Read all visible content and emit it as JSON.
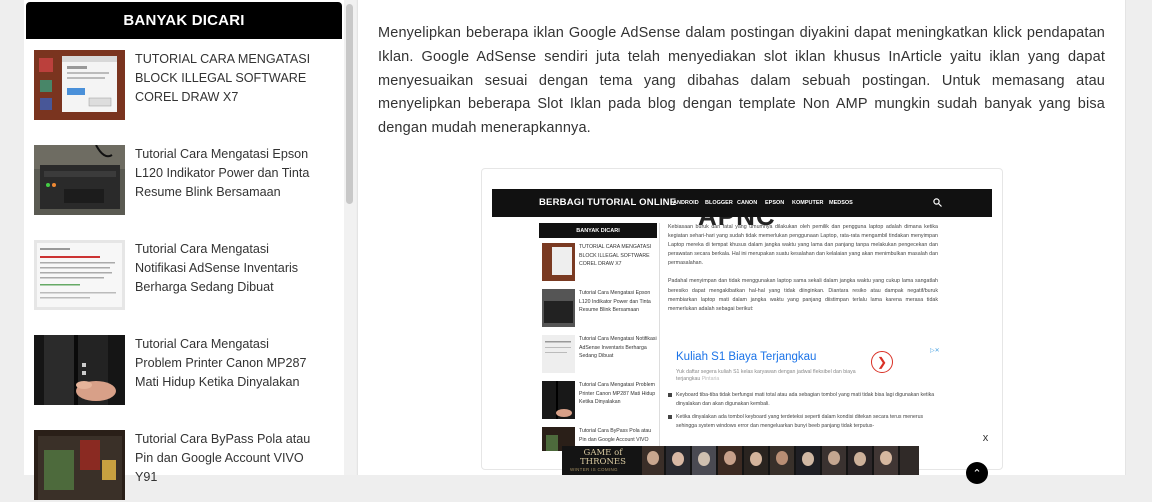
{
  "sidebar": {
    "widget_title": "BANYAK DICARI",
    "posts": [
      {
        "title": "TUTORIAL CARA MENGATASI BLOCK ILLEGAL SOFTWARE COREL DRAW X7"
      },
      {
        "title": "Tutorial Cara Mengatasi Epson L120 Indikator Power dan Tinta Resume Blink Bersamaan"
      },
      {
        "title": "Tutorial Cara Mengatasi Notifikasi AdSense Inventaris Berharga Sedang Dibuat"
      },
      {
        "title": "Tutorial Cara Mengatasi Problem Printer Canon MP287 Mati Hidup Ketika Dinyalakan"
      },
      {
        "title": "Tutorial Cara ByPass Pola atau Pin dan Google Account VIVO Y91"
      }
    ]
  },
  "article": {
    "paragraph": "Menyelipkan beberapa iklan Google AdSense dalam postingan diyakini dapat meningkatkan klick pendapatan Iklan. Google AdSense sendiri juta telah menyediakan slot iklan khusus InArticle yaitu iklan yang dapat menyesuaikan sesuai dengan tema yang dibahas dalam sebuah postingan. Untuk memasang atau menyelipkan  beberapa Slot Iklan pada blog dengan template Non AMP mungkin sudah banyak yang bisa dengan mudah menerapkannya."
  },
  "embedded_screenshot": {
    "brand": "BERBAGI TUTORIAL ONLINE",
    "menu": [
      "ANDROID",
      "BLOGGER",
      "CANON",
      "EPSON",
      "KOMPUTER",
      "MEDSOS"
    ],
    "heading_fragment": "APNC",
    "sidebar_title": "BANYAK DICARI",
    "posts": [
      "TUTORIAL CARA MENGATASI BLOCK ILLEGAL SOFTWARE COREL DRAW X7",
      "Tutorial Cara Mengatasi Epson L120 Indikator Power dan Tinta Resume Blink Bersamaan",
      "Tutorial Cara Mengatasi Notifikasi AdSense Inventaris Berharga Sedang Dibuat",
      "Tutorial Cara Mengatasi Problem Printer Canon MP287 Mati Hidup Ketika Dinyalakan",
      "Tutorial Cara ByPass Pola atau Pin dan Google Account VIVO"
    ],
    "content_p1": "Kebiasaan buruk dan fatal yang umumnya dilakukan oleh pemilik dan pengguna laptop adalah dimana ketika kegiatan sehari-hari yang sudah tidak memerlukan penggunaan Laptop, rata-rata mengambil tindakan menyimpan Laptop mereka di tempat khusus dalam jangka waktu yang lama dan panjang tanpa melakukan pengecekan dan perawatan secara berkala. Hal ini merupakan suatu kesalahan dan kelalaian yang akan menimbulkan masalah dan permasalahan.",
    "content_p2": "Padahal menyimpan dan tidak menggunakan laptop sama sekali dalam jangka waktu yang cukup lama sangatlah beresiko dapat mengakibatkan hal-hal yang tidak diinginkan. Diantara resiko atau dampak negatif/buruk membiarkan laptop mati dalam jangka waktu yang panjang diistimpan terlalu lama karena merasa tidak memerlukan adalah sebagai berikut:",
    "ad_title": "Kuliah S1 Biaya Terjangkau",
    "ad_desc": "Yuk daftar segera kuliah S1 kelas karyawan dengan jadwal fleksibel dan biaya terjangkau",
    "ad_brand": "Pintaria",
    "ad_arrow": "❯",
    "ad_tag": "▷✕",
    "bullet1": "Keyboard tiba-tiba tidak berfungsi mati total atau ada sebagian tombol yang mati tidak bisa lagi digunakan ketika dinyalakan dan akan digunakan kembali.",
    "bullet2": "Ketika dinyalakan ada tombol keyboard yang terdeteksi seperti dalam kondisi ditekan secara terus menerus sehingga system windows error dan mengeluarkan bunyi beeb panjang tidak terputus-"
  },
  "bottom_ad": {
    "logo_line1": "GAME of",
    "logo_line2": "THRONES",
    "tagline": "WINTER IS COMING",
    "close_label": "x",
    "scroll_top_label": "⌃"
  },
  "colors": {
    "accent": "#000000",
    "ad_link": "#1a73e8",
    "ad_button": "#d93025"
  }
}
